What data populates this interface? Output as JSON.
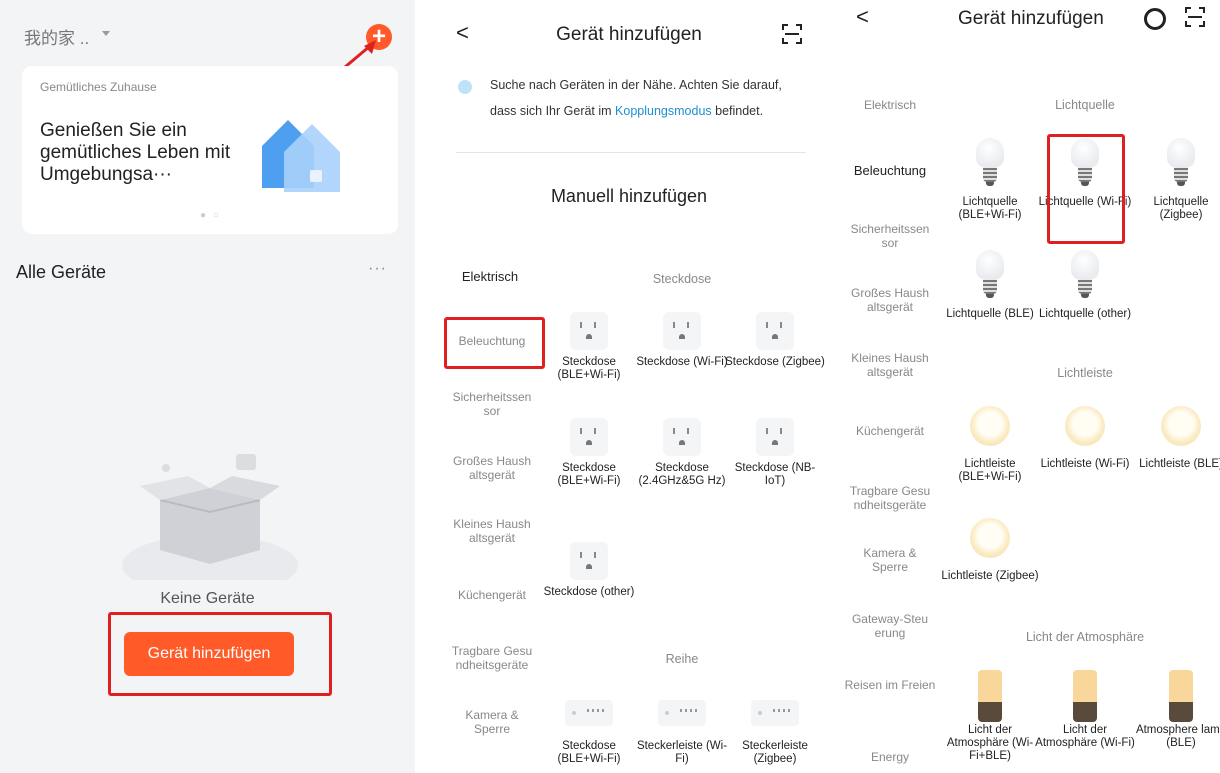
{
  "panel1": {
    "home_title": "我的家 ..",
    "add_symbol": "+",
    "banner": {
      "small": "Gemütliches Zuhause",
      "big": "Genießen Sie ein gemütliches Leben mit Umgebungsa···",
      "dots": "● ○"
    },
    "alle_geraete": "Alle Geräte",
    "more": "···",
    "keine_geraete": "Keine Geräte",
    "add_device_button": "Gerät hinzufügen",
    "colors": {
      "accent": "#ff5a28",
      "highlight": "#e02020"
    }
  },
  "panel2": {
    "back": "<",
    "title": "Gerät hinzufügen",
    "tip_before": "Suche nach Geräten in der Nähe. Achten Sie darauf, dass sich Ihr Gerät im ",
    "tip_link": "Kopplungsmodus",
    "tip_after": " befindet.",
    "manuell": "Manuell hinzufügen",
    "categories": [
      "Elektrisch",
      "Beleuchtung",
      "Sicherheitssen sor",
      "Großes Haush altsgerät",
      "Kleines Haush altsgerät",
      "Küchengerät",
      "Tragbare Gesu ndheitsgeräte",
      "Kamera & Sperre"
    ],
    "section1": "Steckdose",
    "devices1": [
      "Steckdose (BLE+Wi-Fi)",
      "Steckdose (Wi-Fi)",
      "Steckdose (Zigbee)",
      "Steckdose (BLE+Wi-Fi)",
      "Steckdose (2.4GHz&5G Hz)",
      "Steckdose (NB-IoT)",
      "Steckdose (other)"
    ],
    "section2": "Reihe",
    "devices2": [
      "Steckdose (BLE+Wi-Fi)",
      "Steckerleiste (Wi-Fi)",
      "Steckerleiste (Zigbee)"
    ]
  },
  "panel3": {
    "back": "<",
    "title": "Gerät hinzufügen",
    "categories": [
      "Elektrisch",
      "Beleuchtung",
      "Sicherheitssen sor",
      "Großes Haush altsgerät",
      "Kleines Haush altsgerät",
      "Küchengerät",
      "Tragbare Gesu ndheitsgeräte",
      "Kamera & Sperre",
      "Gateway-Steu erung",
      "Reisen im Freien",
      "Energy"
    ],
    "section1": "Lichtquelle",
    "bulbs": [
      "Lichtquelle (BLE+Wi-Fi)",
      "Lichtquelle (Wi-Fi)",
      "Lichtquelle (Zigbee)",
      "Lichtquelle (BLE)",
      "Lichtquelle (other)"
    ],
    "section2": "Lichtleiste",
    "strips": [
      "Lichtleiste (BLE+Wi-Fi)",
      "Lichtleiste (Wi-Fi)",
      "Lichtleiste (BLE)",
      "Lichtleiste (Zigbee)"
    ],
    "section3": "Licht der Atmosphäre",
    "atmos": [
      "Licht der Atmosphäre (Wi-Fi+BLE)",
      "Licht der Atmosphäre (Wi-Fi)",
      "Atmosphere lamp (BLE)"
    ]
  }
}
